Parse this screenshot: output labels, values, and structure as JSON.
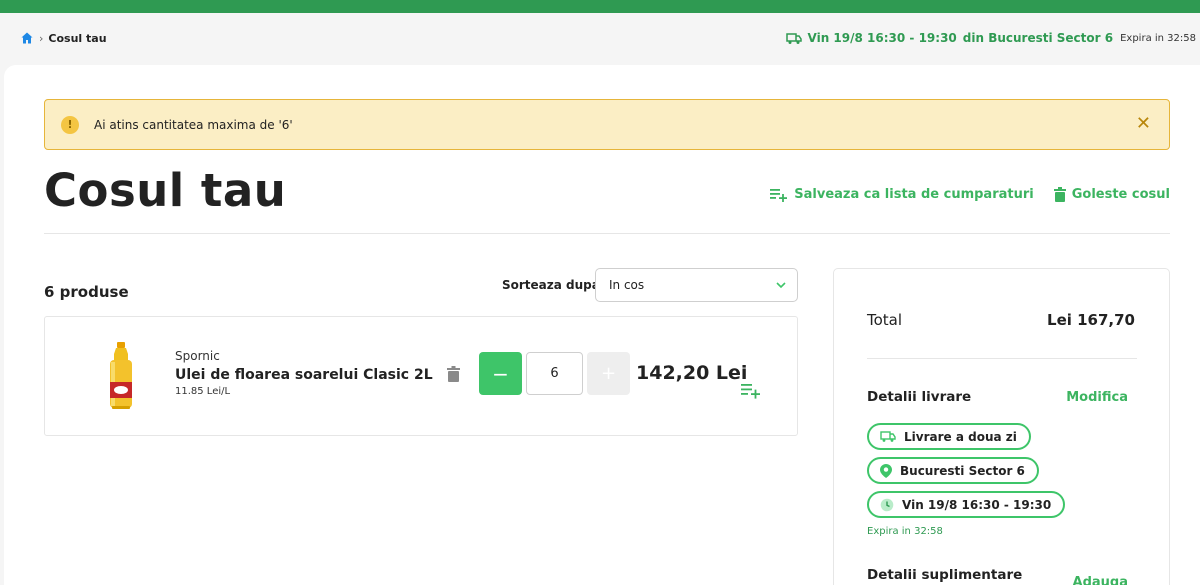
{
  "colors": {
    "brand_green": "#2f9a52",
    "accent_green": "#3ec569",
    "warning_bg": "#fbeec5",
    "warning_border": "#e6b53a"
  },
  "breadcrumb": {
    "icon": "home-icon",
    "current": "Cosul tau"
  },
  "header": {
    "delivery_icon": "truck-icon",
    "slot": "Vin 19/8 16:30 - 19:30",
    "city": "din Bucuresti Sector 6",
    "expires": "Expira in 32:58"
  },
  "alert": {
    "icon": "warning-icon",
    "message": "Ai atins cantitatea maxima de '6'",
    "close_icon": "close-icon"
  },
  "page": {
    "title": "Cosul tau",
    "save_list": "Salveaza ca lista de cumparaturi",
    "empty_cart": "Goleste cosul"
  },
  "list": {
    "count_label": "6 produse",
    "sort_label": "Sorteaza dupa",
    "sort_value": "In cos"
  },
  "product": {
    "brand": "Spornic",
    "name": "Ulei de floarea soarelui Clasic 2L",
    "unit_price": "11.85 Lei/L",
    "minus": "−",
    "quantity": "6",
    "plus": "+",
    "price": "142,20 Lei"
  },
  "summary": {
    "total_label": "Total",
    "total_value": "Lei 167,70",
    "delivery_title": "Detalii livrare",
    "modify": "Modifica",
    "delivery_type": "Livrare a doua zi",
    "location": "Bucuresti Sector 6",
    "slot": "Vin 19/8 16:30 - 19:30",
    "expires": "Expira in 32:58",
    "extra_title": "Detalii suplimentare",
    "add": "Adauga"
  }
}
